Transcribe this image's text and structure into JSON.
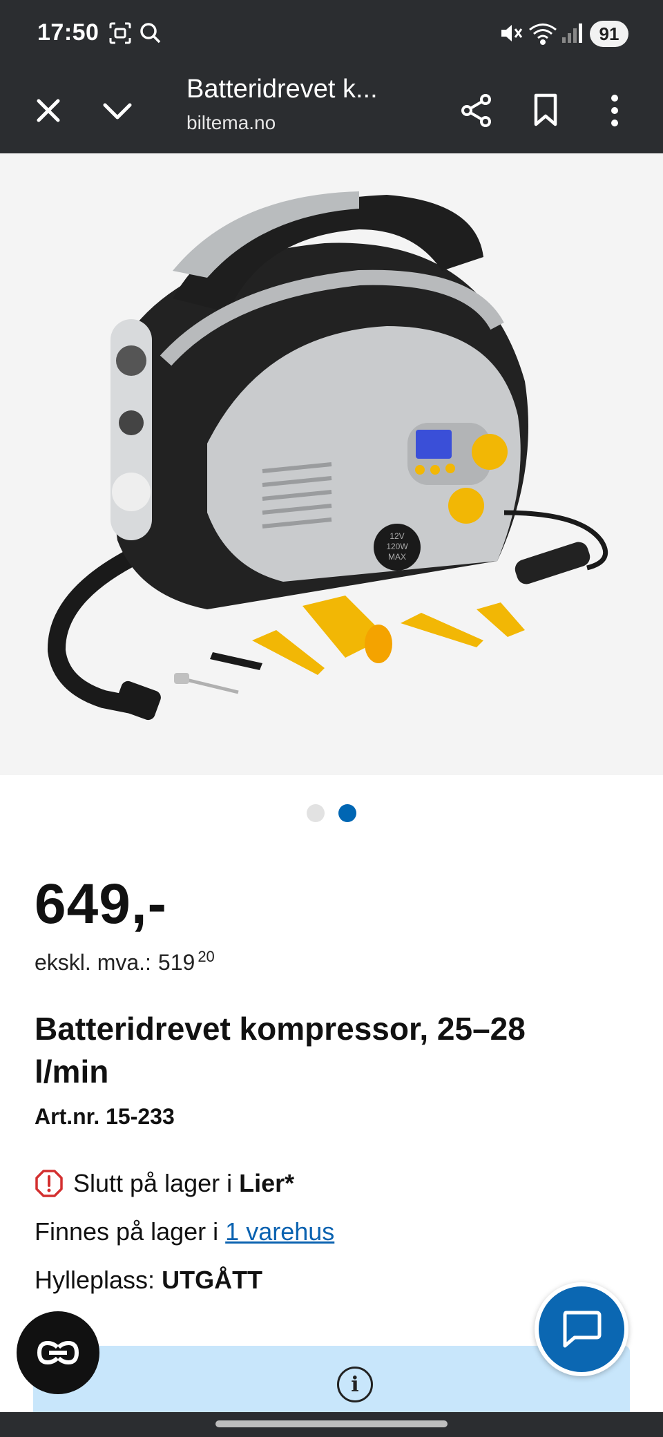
{
  "status_bar": {
    "time": "17:50",
    "battery": "91",
    "icons": [
      "screenshot-icon",
      "search-icon",
      "mute-icon",
      "wifi-icon",
      "signal-icon"
    ]
  },
  "toolbar": {
    "page_title": "Batteridrevet k...",
    "domain": "biltema.no",
    "icons": [
      "close-icon",
      "chevron-down-icon",
      "share-icon",
      "bookmark-icon",
      "more-icon"
    ]
  },
  "product": {
    "price": "649,-",
    "ex_vat_label": "ekskl. mva.:",
    "ex_vat_whole": "519",
    "ex_vat_decimal": "20",
    "name": "Batteridrevet kompressor, 25–28 l/min",
    "art_nr": "Art.nr. 15-233",
    "image_label_lines": [
      "12V",
      "120W",
      "MAX"
    ]
  },
  "carousel": {
    "count": 2,
    "active_index": 1
  },
  "stock": {
    "out_prefix": "Slutt på lager i",
    "out_store": "Lier*",
    "available_prefix": "Finnes på lager i",
    "available_link": "1 varehus",
    "shelf_label": "Hylleplass:",
    "shelf_value": "UTGÅTT"
  },
  "colors": {
    "bar_bg": "#2b2d30",
    "accent_blue": "#0066b3",
    "info_bg": "#c8e6fb",
    "warning_red": "#d32f2f"
  }
}
